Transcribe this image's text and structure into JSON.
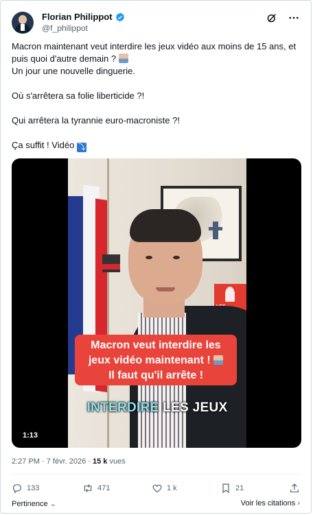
{
  "author": {
    "name": "Florian Philippot",
    "handle": "@f_philippot"
  },
  "tweet": {
    "line1": "Macron maintenant veut interdire les jeux vidéo aux moins de 15 ans, et",
    "line2": "puis quoi d'autre demain ?",
    "line3": "Un jour une nouvelle dinguerie.",
    "line4": "Où s'arrêtera sa folie liberticide ?!",
    "line5": "Qui arrêtera la tyrannie euro-macroniste ?!",
    "line6": "Ça suffit ! Vidéo"
  },
  "video": {
    "banner_line1": "Macron veut interdire les",
    "banner_line2": "jeux vidéo maintenant !",
    "banner_line3": "Il faut qu'il arrête !",
    "caption_highlight": "INTERDIRE",
    "caption_rest": " LES JEUX",
    "logo_text": "LES PATRIOTES",
    "duration": "1:13"
  },
  "meta": {
    "time": "2:27 PM · 7 févr. 2026 · ",
    "views_count": "15 k",
    "views_label": " vues"
  },
  "actions": {
    "replies": "133",
    "reposts": "471",
    "likes": "1 k",
    "bookmarks": "21"
  },
  "footer": {
    "left": "Pertinence",
    "right": "Voir les citations"
  },
  "colors": {
    "verified": "#1d9bf0",
    "banner": "#e8443b",
    "caption_highlight": "#8be2f0"
  },
  "icons": [
    "verified-badge-icon",
    "grok-icon",
    "more-icon",
    "reply-icon",
    "repost-icon",
    "like-icon",
    "bookmark-icon",
    "share-icon",
    "chevron-down-icon",
    "chevron-right-icon"
  ]
}
